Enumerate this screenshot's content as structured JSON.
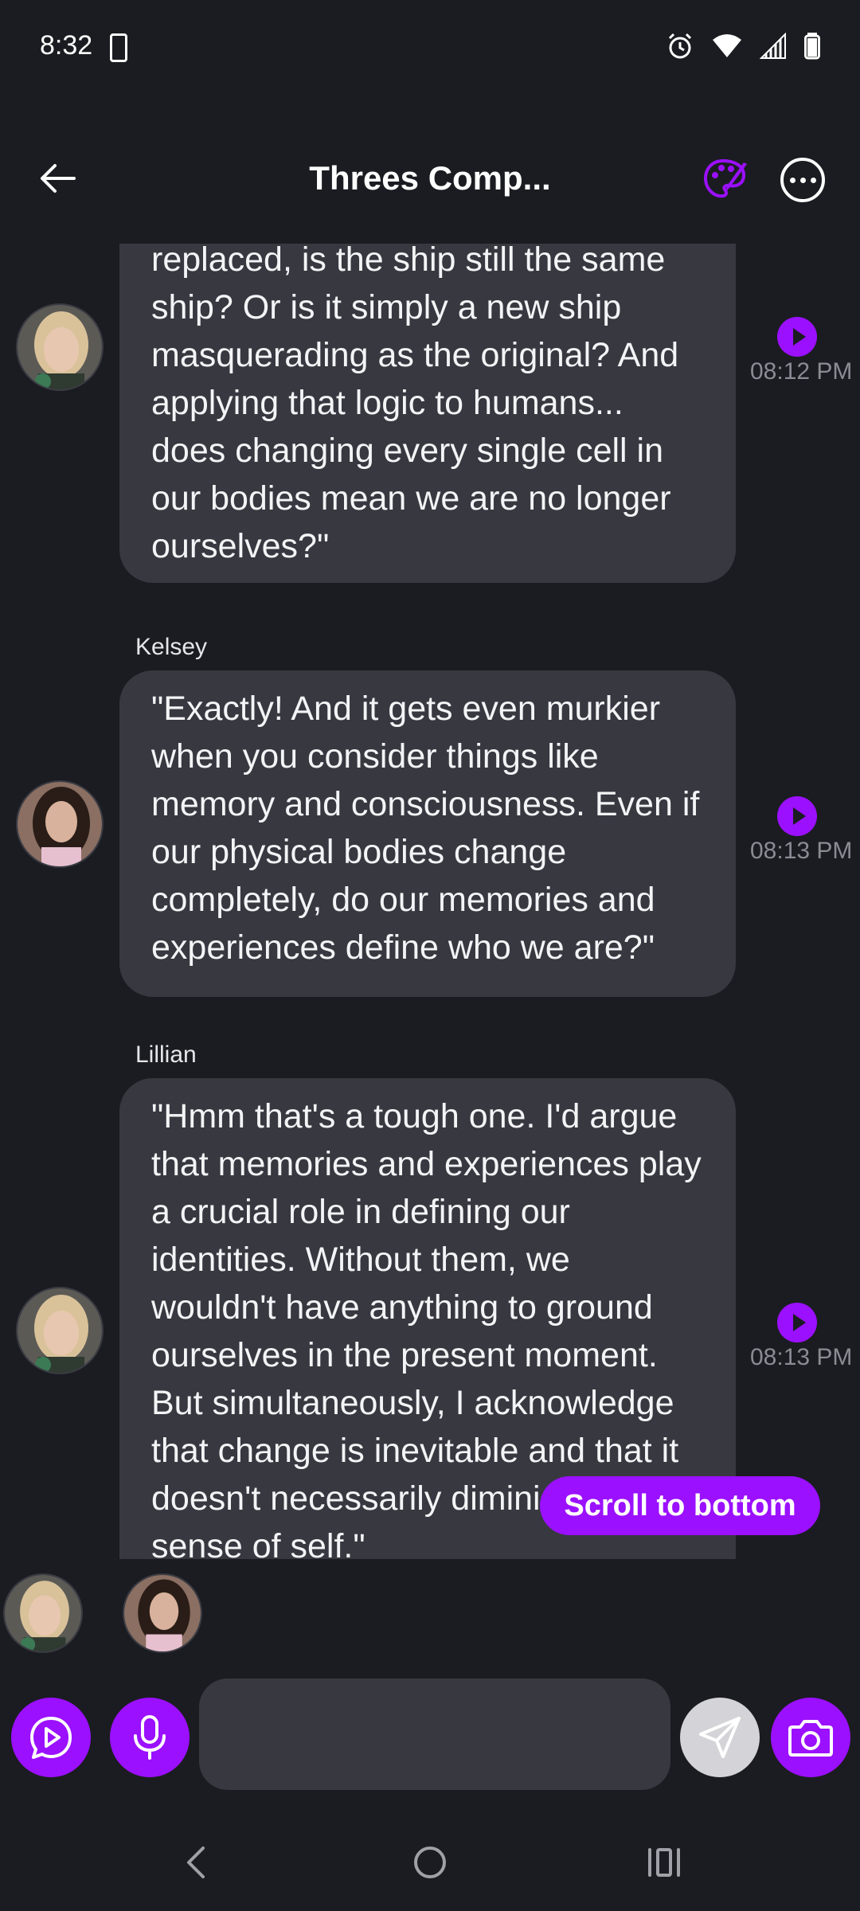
{
  "status_bar": {
    "time": "8:32",
    "icons": [
      "clipboard-check-icon",
      "alarm-icon",
      "wifi-icon",
      "signal-icon",
      "battery-icon"
    ]
  },
  "header": {
    "title": "Threes Comp...",
    "back_icon": "arrow-left-icon",
    "palette_icon": "palette-icon",
    "more_icon": "more-horizontal-icon"
  },
  "colors": {
    "accent": "#9b10ff",
    "background": "#1b1c21",
    "bubble": "#373840",
    "time_text": "#8a8b94"
  },
  "messages": [
    {
      "sender": "",
      "text": "replaced, is the ship still the same ship? Or is it simply a new ship masquerading as the original? And applying that logic to humans... does changing every single cell in our bodies mean we are no longer ourselves?\"",
      "time": "08:12 PM",
      "avatar": "avatar-blonde"
    },
    {
      "sender": "Kelsey",
      "text": "\"Exactly! And it gets even murkier when you consider things like memory and consciousness. Even if our physical bodies change completely, do our memories and experiences define who we are?\"",
      "time": "08:13 PM",
      "avatar": "avatar-brunette"
    },
    {
      "sender": "Lillian",
      "text": "\"Hmm that's a tough one. I'd argue that memories and experiences play a crucial role in defining our identities. Without them, we wouldn't have anything to ground ourselves in the present moment. But simultaneously, I acknowledge that change is inevitable and that it doesn't necessarily diminish our sense of self.\"",
      "time": "08:13 PM",
      "avatar": "avatar-blonde"
    }
  ],
  "scroll_to_bottom_label": "Scroll to bottom",
  "composer": {
    "placeholder": "",
    "value": ""
  },
  "nav": {
    "back_icon": "nav-back-icon",
    "home_icon": "nav-home-icon",
    "recents_icon": "nav-recents-icon"
  }
}
